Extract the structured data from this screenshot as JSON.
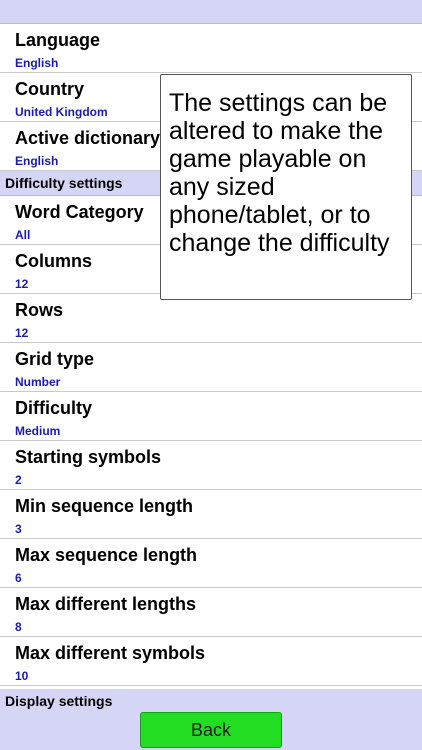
{
  "settings_top": [
    {
      "title": "Language",
      "value": "English"
    },
    {
      "title": "Country",
      "value": "United Kingdom"
    },
    {
      "title": "Active dictionary",
      "value": "English"
    }
  ],
  "difficulty_section": {
    "label": "Difficulty settings",
    "items": [
      {
        "title": "Word Category",
        "value": "All"
      },
      {
        "title": "Columns",
        "value": "12"
      },
      {
        "title": "Rows",
        "value": "12"
      },
      {
        "title": "Grid type",
        "value": "Number"
      },
      {
        "title": "Difficulty",
        "value": "Medium"
      },
      {
        "title": "Starting symbols",
        "value": "2"
      },
      {
        "title": "Min sequence length",
        "value": "3"
      },
      {
        "title": "Max sequence length",
        "value": "6"
      },
      {
        "title": "Max different lengths",
        "value": "8"
      },
      {
        "title": "Max different symbols",
        "value": "10"
      }
    ]
  },
  "display_section": {
    "label": "Display settings"
  },
  "back_button": {
    "label": "Back"
  },
  "tooltip": {
    "text": "The settings can be altered to make the game playable on any sized phone/tablet, or to change the difficulty"
  },
  "colors": {
    "header_bg": "#d5d5f5",
    "value_text": "#1b1bb3",
    "back_button": "#22dd22"
  }
}
